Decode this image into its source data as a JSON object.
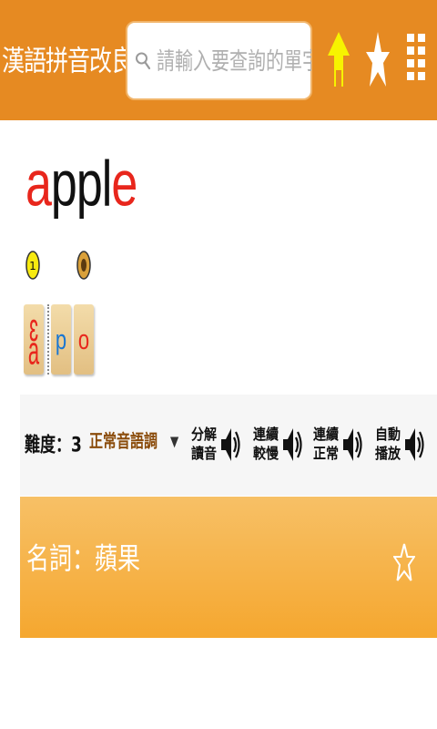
{
  "header": {
    "app_title": "漢語拼音改良版",
    "search_placeholder": "請輸入要查詢的單字",
    "colors": {
      "bar": "#e68a22",
      "home_icon": "#f7f300",
      "icon": "#ffffff"
    }
  },
  "word": {
    "parts": [
      {
        "text": "a",
        "color": "red"
      },
      {
        "text": "ppl",
        "color": "black"
      },
      {
        "text": "e",
        "color": "red"
      }
    ]
  },
  "tone_markers": [
    {
      "label": "1",
      "type": "first-tone"
    },
    {
      "label": "",
      "type": "neutral"
    }
  ],
  "phonetic_tiles": [
    {
      "symbol": "ɛ",
      "sub": "a",
      "color": "#e8261c"
    },
    {
      "symbol": "p",
      "color": "#1976d2"
    },
    {
      "symbol": "o",
      "color": "#e8261c"
    }
  ],
  "controls": {
    "difficulty": "難度：3",
    "tone_option": "正常音語調",
    "buttons": [
      {
        "line1": "分解",
        "line2": "讀音"
      },
      {
        "line1": "連續",
        "line2": "較慢"
      },
      {
        "line1": "連續",
        "line2": "正常"
      },
      {
        "line1": "自動",
        "line2": "播放"
      }
    ]
  },
  "definition": {
    "text": "名詞：蘋果"
  }
}
